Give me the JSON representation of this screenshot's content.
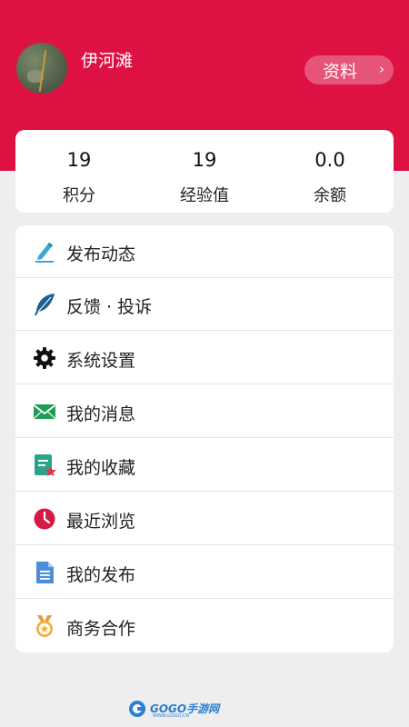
{
  "profile": {
    "username": "伊河滩",
    "profile_button_label": "资料"
  },
  "stats": [
    {
      "value": "19",
      "label": "积分"
    },
    {
      "value": "19",
      "label": "经验值"
    },
    {
      "value": "0.0",
      "label": "余额"
    }
  ],
  "menu": [
    {
      "label": "发布动态",
      "icon": "pen-icon"
    },
    {
      "label": "反馈 · 投诉",
      "icon": "quill-feather-icon"
    },
    {
      "label": "系统设置",
      "icon": "gear-icon"
    },
    {
      "label": "我的消息",
      "icon": "envelope-icon"
    },
    {
      "label": "我的收藏",
      "icon": "bookmark-star-icon"
    },
    {
      "label": "最近浏览",
      "icon": "clock-icon"
    },
    {
      "label": "我的发布",
      "icon": "document-icon"
    },
    {
      "label": "商务合作",
      "icon": "medal-icon"
    }
  ],
  "watermark": {
    "text": "GOGO手游网",
    "sub": "WWW.GOGO.CN"
  },
  "colors": {
    "header_bg": "#dd1243",
    "page_bg": "#eeeeee"
  }
}
